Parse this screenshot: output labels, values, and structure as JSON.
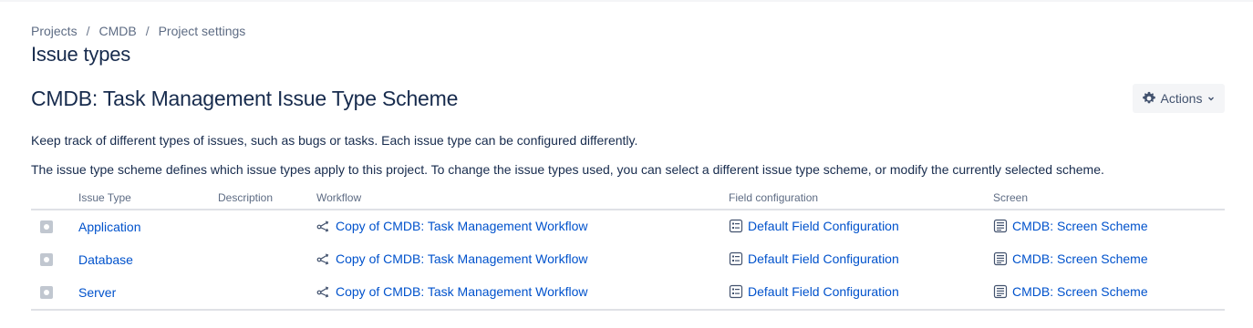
{
  "breadcrumb": {
    "items": [
      "Projects",
      "CMDB",
      "Project settings"
    ],
    "separator": "/"
  },
  "page_title": "Issue types",
  "scheme_title": "CMDB: Task Management Issue Type Scheme",
  "actions_button": {
    "label": "Actions",
    "icon": "gear-icon"
  },
  "descriptions": [
    "Keep track of different types of issues, such as bugs or tasks. Each issue type can be configured differently.",
    "The issue type scheme defines which issue types apply to this project. To change the issue types used, you can select a different issue type scheme, or modify the currently selected scheme."
  ],
  "table": {
    "headers": {
      "issue_type": "Issue Type",
      "description": "Description",
      "workflow": "Workflow",
      "field_configuration": "Field configuration",
      "screen": "Screen"
    },
    "rows": [
      {
        "issue_type": "Application",
        "description": "",
        "workflow": "Copy of CMDB: Task Management Workflow",
        "field_configuration": "Default Field Configuration",
        "screen": "CMDB: Screen Scheme"
      },
      {
        "issue_type": "Database",
        "description": "",
        "workflow": "Copy of CMDB: Task Management Workflow",
        "field_configuration": "Default Field Configuration",
        "screen": "CMDB: Screen Scheme"
      },
      {
        "issue_type": "Server",
        "description": "",
        "workflow": "Copy of CMDB: Task Management Workflow",
        "field_configuration": "Default Field Configuration",
        "screen": "CMDB: Screen Scheme"
      }
    ]
  },
  "colors": {
    "link": "#0052cc",
    "text": "#172b4d",
    "muted": "#5e6c84",
    "button_bg": "#f4f5f7"
  }
}
